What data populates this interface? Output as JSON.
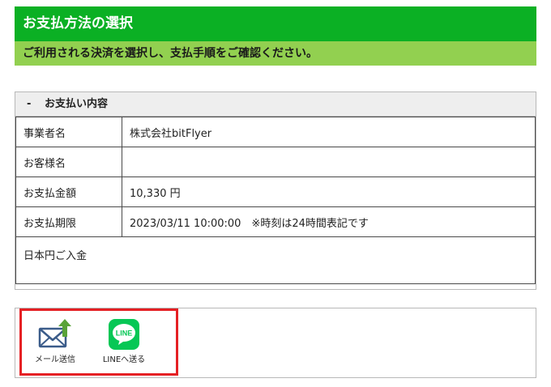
{
  "header": {
    "title": "お支払方法の選択",
    "subtitle": "ご利用される決済を選択し、支払手順をご確認ください。"
  },
  "payment_panel": {
    "toggle": "-",
    "title": "お支払い内容",
    "rows": [
      {
        "label": "事業者名",
        "value": "株式会社bitFlyer"
      },
      {
        "label": "お客様名",
        "value": ""
      },
      {
        "label": "お支払金額",
        "value": "10,330 円"
      },
      {
        "label": "お支払期限",
        "value": "2023/03/11 10:00:00　※時刻は24時間表記です"
      }
    ],
    "note": "日本円ご入金"
  },
  "share": {
    "mail_label": "メール送信",
    "line_label": "LINEへ送る",
    "line_icon_text": "LINE"
  },
  "colors": {
    "header_green": "#0bb024",
    "sub_green": "#92d050",
    "line_green": "#06c755",
    "highlight_red": "#e52024"
  },
  "icons": [
    "mail-icon",
    "upload-arrow-icon",
    "line-icon"
  ]
}
